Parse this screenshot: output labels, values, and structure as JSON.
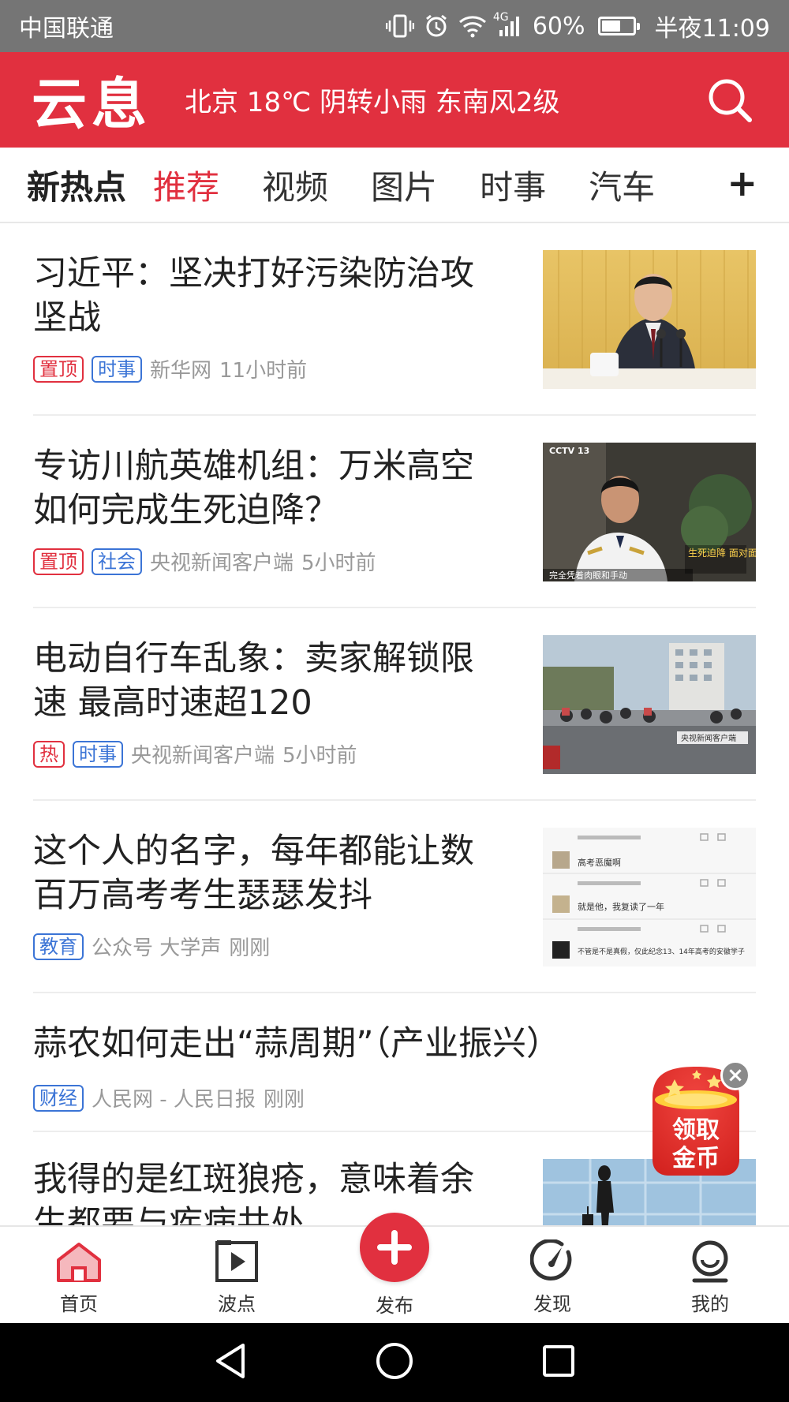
{
  "status_bar": {
    "carrier": "中国联通",
    "network": "4G",
    "battery_text": "60%",
    "battery_level": 0.6,
    "time": "半夜11:09"
  },
  "header": {
    "logo": "云息",
    "weather": "北京 18℃ 阴转小雨 东南风2级",
    "search_icon": "search-icon",
    "bg_color": "#e1303f"
  },
  "tabs": {
    "brand": "新热点",
    "items": [
      "推荐",
      "视频",
      "图片",
      "时事",
      "汽车"
    ],
    "active": "推荐",
    "plus": "+"
  },
  "feed": [
    {
      "title": "习近平：坚决打好污染防治攻坚战",
      "tags": [
        {
          "text": "置顶",
          "color": "red"
        },
        {
          "text": "时事",
          "color": "blue"
        }
      ],
      "source": "新华网",
      "time": "11小时前",
      "thumb": "official-speech"
    },
    {
      "title": "专访川航英雄机组：万米高空如何完成生死迫降？",
      "tags": [
        {
          "text": "置顶",
          "color": "red"
        },
        {
          "text": "社会",
          "color": "blue"
        }
      ],
      "source": "央视新闻客户端",
      "time": "5小时前",
      "thumb": "pilot-interview"
    },
    {
      "title": "电动自行车乱象：卖家解锁限速 最高时速超120",
      "tags": [
        {
          "text": "热",
          "color": "red"
        },
        {
          "text": "时事",
          "color": "blue"
        }
      ],
      "source": "央视新闻客户端",
      "time": "5小时前",
      "thumb": "street-scooters"
    },
    {
      "title": "这个人的名字，每年都能让数百万高考考生瑟瑟发抖",
      "tags": [
        {
          "text": "教育",
          "color": "blue"
        }
      ],
      "source": "公众号 大学声",
      "time": "刚刚",
      "thumb": "comments-screenshot"
    },
    {
      "title": "蒜农如何走出“蒜周期”（产业振兴）",
      "tags": [
        {
          "text": "财经",
          "color": "blue"
        }
      ],
      "source": "人民网 - 人民日报",
      "time": "刚刚",
      "thumb": ""
    },
    {
      "title": "我得的是红斑狼疮，意味着余生都要与疾病共处",
      "tags": [],
      "source": "",
      "time": "",
      "thumb": "airport-traveler"
    }
  ],
  "thumb_texts": {
    "cctv_logo": "CCTV 13",
    "cctv_caption": "生死迫降 面对面",
    "cctv_sub": "完全凭着肉眼和手动",
    "street_watermark": "央视新闻客户端",
    "comment_1": "高考恶魔啊",
    "comment_2": "就是他，我复读了一年",
    "comment_3": "不管是不是真假，仅此纪念13、14年高考的安徽学子"
  },
  "coin_widget": {
    "line1": "领取",
    "line2": "金币",
    "close": "×"
  },
  "bottom_nav": [
    {
      "label": "首页",
      "icon": "home-icon",
      "active": true
    },
    {
      "label": "波点",
      "icon": "play-square-icon",
      "active": false
    },
    {
      "label": "发布",
      "icon": "plus-circle-icon",
      "active": false
    },
    {
      "label": "发现",
      "icon": "compass-icon",
      "active": false
    },
    {
      "label": "我的",
      "icon": "profile-icon",
      "active": false
    }
  ]
}
